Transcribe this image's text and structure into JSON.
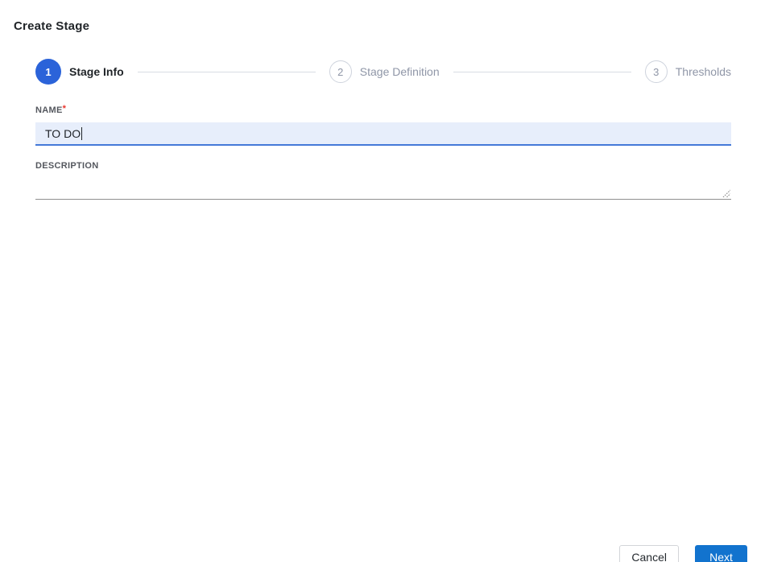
{
  "page": {
    "title": "Create Stage"
  },
  "stepper": {
    "steps": [
      {
        "number": "1",
        "label": "Stage Info",
        "state": "active"
      },
      {
        "number": "2",
        "label": "Stage Definition",
        "state": "inactive"
      },
      {
        "number": "3",
        "label": "Thresholds",
        "state": "inactive"
      }
    ]
  },
  "form": {
    "name": {
      "label": "NAME",
      "required_marker": "*",
      "value": "TO DO",
      "placeholder": ""
    },
    "description": {
      "label": "DESCRIPTION",
      "value": "",
      "placeholder": ""
    }
  },
  "footer": {
    "cancel_label": "Cancel",
    "next_label": "Next"
  },
  "icons": {
    "resize_handle": "textarea-resize-handle-icon",
    "text_cursor": "text-cursor-caret"
  },
  "colors": {
    "active_step_blue": "#2b63d9",
    "primary_button_blue": "#1273ce",
    "input_focus_background": "#e7eefb",
    "input_focus_border": "#4479d8",
    "required_red": "#e8362d",
    "inactive_step_gray": "#8f96a7",
    "connector_line_gray": "#d8dce3"
  }
}
